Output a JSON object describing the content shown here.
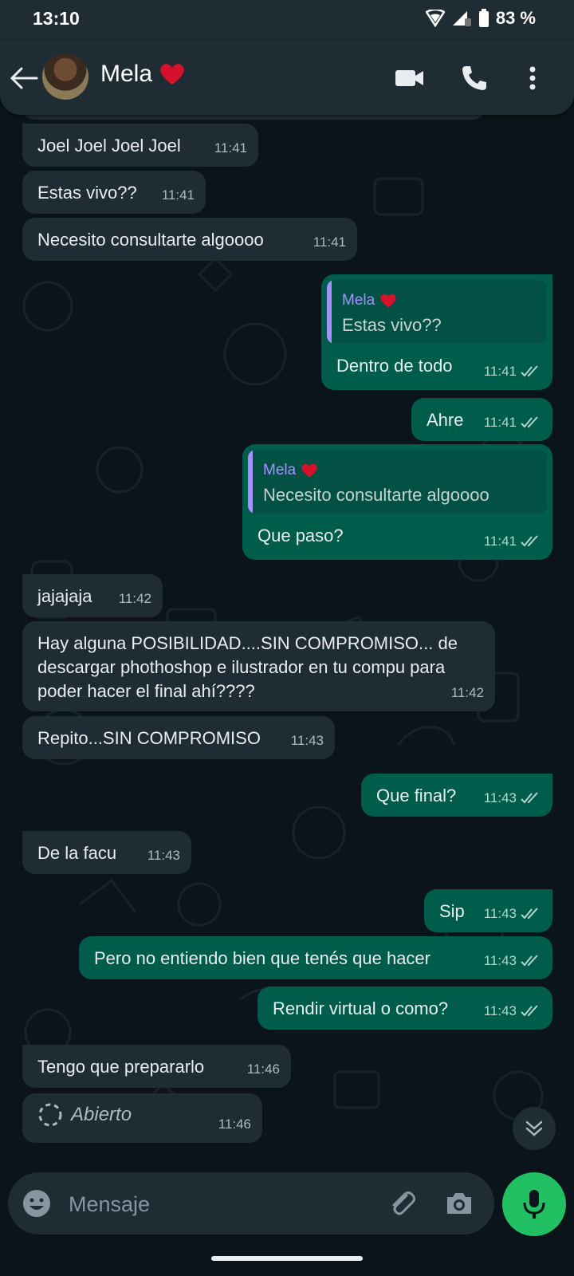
{
  "status_bar": {
    "time": "13:10",
    "battery": "83 %"
  },
  "header": {
    "contact_name": "Mela",
    "name_emoji": "heart-icon"
  },
  "messages": [
    {
      "dir": "in",
      "text": "Joel Joel Joel Joel",
      "time": "11:41"
    },
    {
      "dir": "in",
      "text": "Estas vivo??",
      "time": "11:41"
    },
    {
      "dir": "in",
      "text": "Necesito consultarte algoooo",
      "time": "11:41"
    },
    {
      "dir": "out",
      "quote_author": "Mela",
      "quote_text": "Estas vivo??",
      "text": "Dentro de todo",
      "time": "11:41"
    },
    {
      "dir": "out",
      "text": "Ahre",
      "time": "11:41"
    },
    {
      "dir": "out",
      "quote_author": "Mela",
      "quote_text": "Necesito consultarte algoooo",
      "text": "Que paso?",
      "time": "11:41"
    },
    {
      "dir": "in",
      "text": "jajajaja",
      "time": "11:42"
    },
    {
      "dir": "in",
      "text": "Hay alguna POSIBILIDAD....SIN COMPROMISO... de descargar phothoshop e ilustrador en tu compu para poder hacer el final ahí????",
      "time": "11:42"
    },
    {
      "dir": "in",
      "text": "Repito...SIN COMPROMISO",
      "time": "11:43"
    },
    {
      "dir": "out",
      "text": "Que final?",
      "time": "11:43"
    },
    {
      "dir": "in",
      "text": "De la facu",
      "time": "11:43"
    },
    {
      "dir": "out",
      "text": "Sip",
      "time": "11:43"
    },
    {
      "dir": "out",
      "text": "Pero no entiendo bien que tenés que hacer",
      "time": "11:43"
    },
    {
      "dir": "out",
      "text": "Rendir virtual o como?",
      "time": "11:43"
    },
    {
      "dir": "in",
      "text": "Tengo que prepararlo",
      "time": "11:46"
    },
    {
      "dir": "in",
      "view_once_label": "Abierto",
      "time": "11:46"
    }
  ],
  "composer": {
    "placeholder": "Mensaje"
  },
  "colors": {
    "incoming": "#1f2c34",
    "outgoing": "#005c4b",
    "accent": "#21c063",
    "quote_author": "#a791ff"
  }
}
